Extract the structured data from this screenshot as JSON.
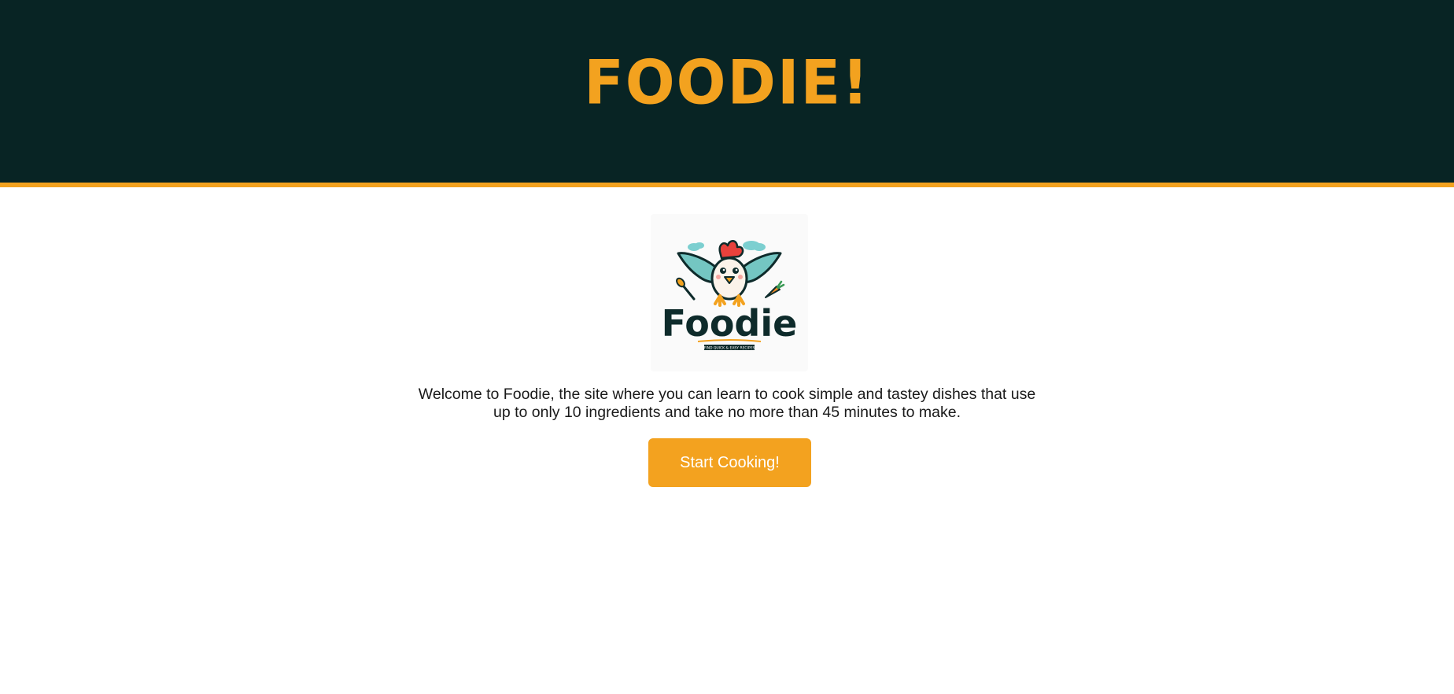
{
  "header": {
    "title": "FOODIE!"
  },
  "logo": {
    "wordmark": "Foodie",
    "tagline": "FIND QUICK & EASY RECIPES"
  },
  "main": {
    "welcome_text": "Welcome to Foodie, the site where you can learn to cook simple and tastey dishes that use up to only 10 ingredients and take no more than 45 minutes to make.",
    "cta_label": "Start Cooking!"
  },
  "colors": {
    "header_bg": "#082424",
    "accent": "#f3a21f",
    "text": "#1a1a1a",
    "button_text": "#ffffff"
  }
}
